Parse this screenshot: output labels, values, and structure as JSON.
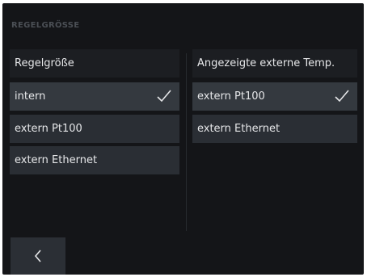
{
  "screen": {
    "title": "REGELGRÖSSE"
  },
  "left_column": {
    "header": "Regelgröße",
    "options": [
      {
        "label": "intern",
        "selected": true
      },
      {
        "label": "extern Pt100",
        "selected": false
      },
      {
        "label": "extern Ethernet",
        "selected": false
      }
    ]
  },
  "right_column": {
    "header": "Angezeigte externe Temp.",
    "options": [
      {
        "label": "extern Pt100",
        "selected": true
      },
      {
        "label": "extern Ethernet",
        "selected": false
      }
    ]
  },
  "footer": {
    "back_icon": "chevron-left-icon"
  },
  "colors": {
    "background": "#141518",
    "option": "#2a2e34",
    "option_selected": "#34393f",
    "text": "#e6e7e9"
  }
}
